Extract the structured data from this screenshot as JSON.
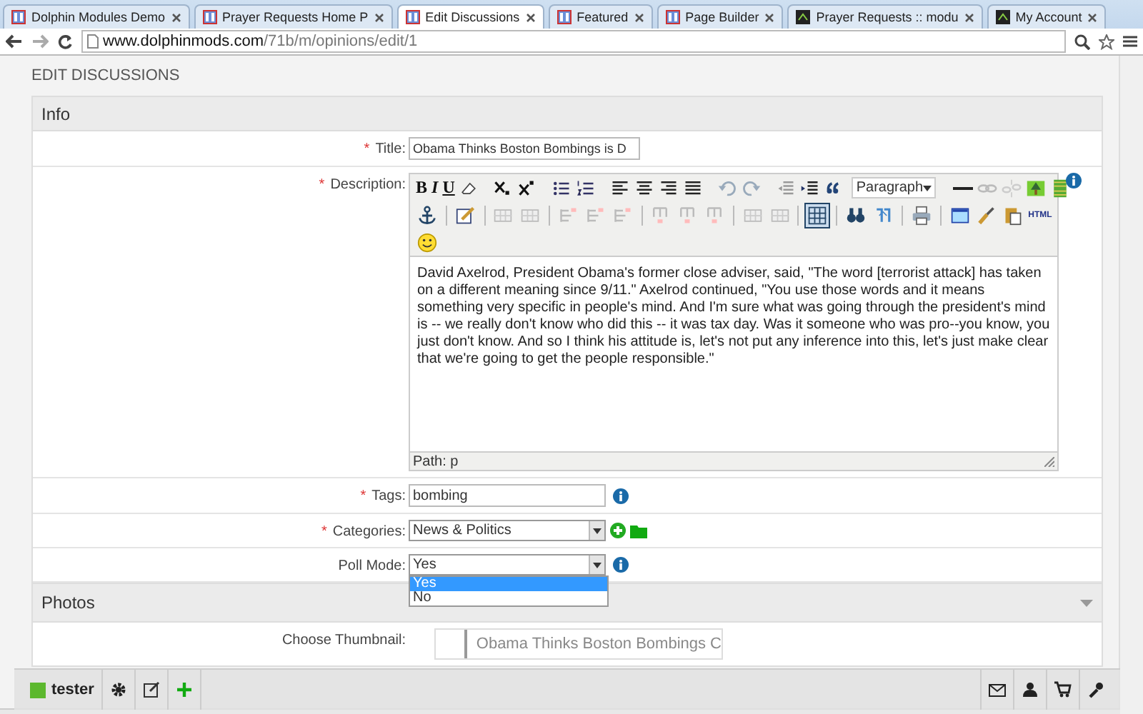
{
  "browser": {
    "tabs": [
      {
        "title": "Dolphin Modules Demo",
        "kind": "site",
        "selected": false
      },
      {
        "title": "Prayer Requests Home P",
        "kind": "site",
        "selected": false
      },
      {
        "title": "Edit Discussions",
        "kind": "site",
        "selected": true
      },
      {
        "title": "Featured",
        "kind": "site",
        "selected": false
      },
      {
        "title": "Page Builder",
        "kind": "site",
        "selected": false
      },
      {
        "title": "Prayer Requests :: modu",
        "kind": "dark",
        "selected": false
      },
      {
        "title": "My Account",
        "kind": "dark",
        "selected": false
      }
    ],
    "url_domain": "www.dolphinmods.com",
    "url_path": "/71b/m/opinions/edit/1"
  },
  "page_title": "EDIT DISCUSSIONS",
  "required_mark": "*",
  "info": {
    "title": "Info",
    "fields": [
      {
        "kind": "text",
        "label": "Title:",
        "required": true,
        "value": "Obama Thinks Boston Bombings is D"
      },
      {
        "kind": "editor",
        "label": "Description:",
        "required": true
      },
      {
        "kind": "tags",
        "label": "Tags:",
        "required": true,
        "value": "bombing"
      },
      {
        "kind": "category",
        "label": "Categories:",
        "required": true,
        "value": "News & Politics"
      },
      {
        "kind": "poll",
        "label": "Poll Mode:",
        "required": false,
        "value": "Yes",
        "open": true,
        "options": [
          {
            "label": "Yes",
            "selected": true
          },
          {
            "label": "No",
            "selected": false
          }
        ]
      }
    ]
  },
  "editor": {
    "letters": [
      "B",
      "I",
      "U"
    ],
    "block_format": "Paragraph",
    "html_label": "HTML",
    "content": "David Axelrod, President Obama's former close adviser, said, \"The word [terrorist attack] has taken on a different meaning since 9/11.\" Axelrod continued, \"You use those words and it means something very specific in people's mind. And I'm sure what was going through the president's mind is -- we really don't know who did this -- it was tax day. Was it someone who was pro--you know, you just don't know. And so I think his attitude is, let's not put any inference into this, let's just make clear that we're going to get the people responsible.\"",
    "path": "Path: p"
  },
  "photos": {
    "title": "Photos",
    "thumbnail_label": "Choose Thumbnail:",
    "thumbnail_item": "Obama Thinks Boston Bombings C"
  },
  "bottom_bar": {
    "user": "tester",
    "online": true
  }
}
